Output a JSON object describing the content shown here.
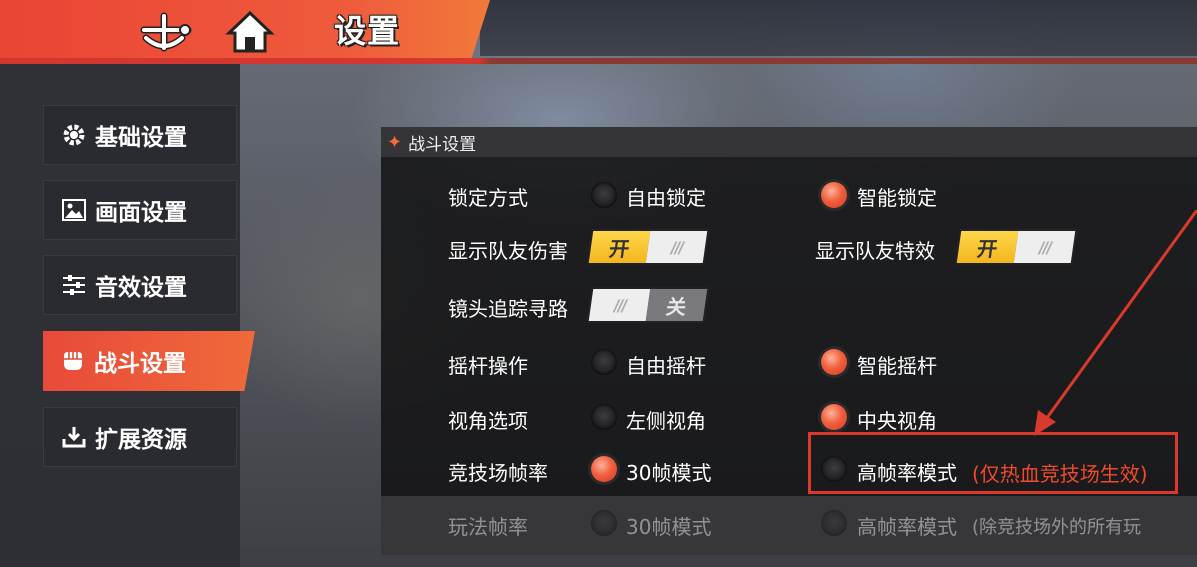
{
  "header": {
    "title": "设置"
  },
  "sidebar": {
    "items": [
      {
        "label": "基础设置",
        "icon": "gear-icon"
      },
      {
        "label": "画面设置",
        "icon": "image-icon"
      },
      {
        "label": "音效设置",
        "icon": "sliders-icon"
      },
      {
        "label": "战斗设置",
        "icon": "fist-icon",
        "active": true
      },
      {
        "label": "扩展资源",
        "icon": "download-icon"
      }
    ]
  },
  "panel": {
    "title": "战斗设置",
    "lock": {
      "label": "锁定方式",
      "opt1": "自由锁定",
      "opt2": "智能锁定",
      "selected": "智能锁定"
    },
    "teammate_damage": {
      "label": "显示队友伤害",
      "on": "开",
      "off_mark": "///",
      "state": "开"
    },
    "teammate_effects": {
      "label": "显示队友特效",
      "on": "开",
      "off_mark": "///",
      "state": "开"
    },
    "camera_track": {
      "label": "镜头追踪寻路",
      "off": "关",
      "on_mark": "///",
      "state": "关"
    },
    "joystick": {
      "label": "摇杆操作",
      "opt1": "自由摇杆",
      "opt2": "智能摇杆",
      "selected": "智能摇杆"
    },
    "view": {
      "label": "视角选项",
      "opt1": "左侧视角",
      "opt2": "中央视角",
      "selected": "中央视角"
    },
    "arena_fps": {
      "label": "竞技场帧率",
      "opt1": "30帧模式",
      "opt2": "高帧率模式",
      "note": "(仅热血竞技场生效)",
      "selected": "30帧模式"
    },
    "play_fps": {
      "label": "玩法帧率",
      "opt1": "30帧模式",
      "opt2": "高帧率模式",
      "note": "(除竞技场外的所有玩",
      "selected": "none"
    }
  },
  "colors": {
    "accent": "#ef5a3c",
    "toggle_on": "#f3b51f",
    "annotation": "#d93a2c"
  }
}
